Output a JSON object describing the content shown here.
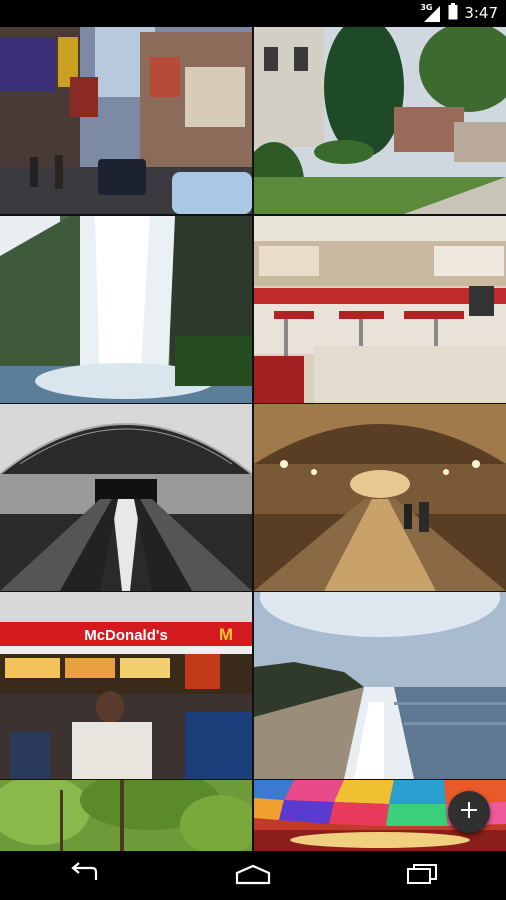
{
  "status_bar": {
    "signal_badge": "3G",
    "time": "3:47",
    "icons": [
      "signal-icon",
      "battery-icon"
    ]
  },
  "gallery": {
    "photos": [
      {
        "subject": "Chinatown street with shop signs and cars",
        "sign_text": ""
      },
      {
        "subject": "Suburban houses with lawn and trees",
        "sign_text": ""
      },
      {
        "subject": "Waterfall over green cliff",
        "sign_text": ""
      },
      {
        "subject": "Retro diner with red stools",
        "sign_text": ""
      },
      {
        "subject": "Metro station vaulted ceiling (black & white)",
        "sign_text": ""
      },
      {
        "subject": "Underground pedestrian tunnel",
        "sign_text": ""
      },
      {
        "subject": "McDonald's food court with crowd",
        "sign_text": "McDonald's"
      },
      {
        "subject": "Beach shoreline with palm trees",
        "sign_text": ""
      },
      {
        "subject": "Green tree canopy",
        "sign_text": ""
      },
      {
        "subject": "Colorful patterned ceiling",
        "sign_text": ""
      }
    ]
  },
  "fab": {
    "icon": "plus-icon"
  },
  "nav_bar": {
    "icons": [
      "back-icon",
      "home-icon",
      "recent-apps-icon"
    ]
  },
  "colors": {
    "fab_bg": "#303030",
    "system_bar": "#000000",
    "mcdonalds_red": "#d21a1f",
    "mcdonalds_yellow": "#ffc72c"
  }
}
